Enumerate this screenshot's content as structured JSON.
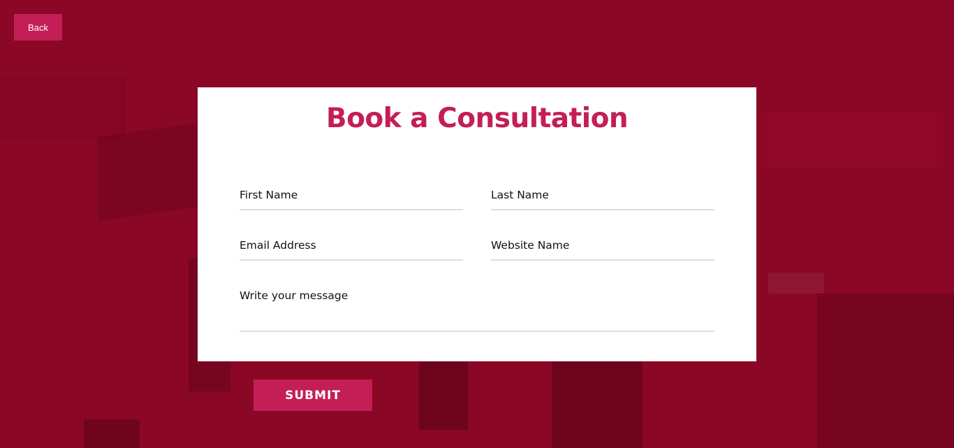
{
  "colors": {
    "background": "#8a0726",
    "accent": "#c41e57",
    "card": "#ffffff",
    "field_underline": "#dedede"
  },
  "nav": {
    "back_label": "Back"
  },
  "form": {
    "title": "Book a Consultation",
    "fields": {
      "first_name": {
        "placeholder": "First Name",
        "value": ""
      },
      "last_name": {
        "placeholder": "Last Name",
        "value": ""
      },
      "email": {
        "placeholder": "Email Address",
        "value": ""
      },
      "website": {
        "placeholder": "Website Name",
        "value": ""
      },
      "message": {
        "placeholder": "Write your message",
        "value": ""
      }
    },
    "submit_label": "SUBMIT"
  }
}
